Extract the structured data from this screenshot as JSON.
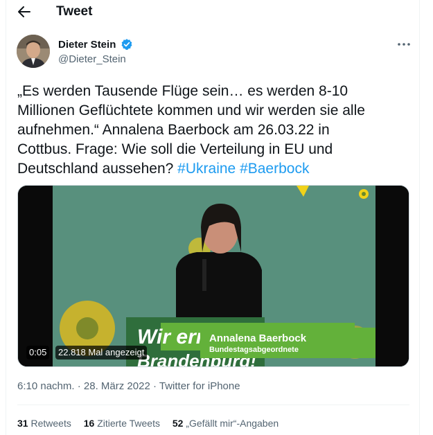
{
  "header": {
    "title": "Tweet"
  },
  "author": {
    "name": "Dieter Stein",
    "handle": "@Dieter_Stein"
  },
  "tweet": {
    "line1": "„Es werden Tausende Flüge sein… es werden 8-10",
    "line2": "Millionen Geflüchtete kommen und wir werden sie alle",
    "line3": "aufnehmen.“ Annalena Baerbock am 26.03.22 in",
    "line4": "Cottbus. Frage: Wie soll die Verteilung in EU und",
    "line5_text": "Deutschland aussehen? ",
    "hashtag1": "#Ukraine",
    "hashtag2": "#Baerbock"
  },
  "media": {
    "lower_third_name": "Annalena Baerbock",
    "lower_third_title": "Bundestagsabgeordnete",
    "banner_text_1": "Wir ern",
    "banner_text_2": "Brandenburg!",
    "time": "0:05",
    "views": "22.818 Mal angezeigt"
  },
  "meta": {
    "time": "6:10 nachm.",
    "date": "28. März 2022",
    "source": "Twitter for iPhone",
    "sep": " · "
  },
  "stats": {
    "retweets_count": "31",
    "retweets_label": "Retweets",
    "quotes_count": "16",
    "quotes_label": "Zitierte Tweets",
    "likes_count": "52",
    "likes_label": "„Gefällt mir“-Angaben"
  },
  "colors": {
    "link": "#1d9bf0",
    "verified": "#1d9bf0",
    "stage_green": "#5a8f7b",
    "lower_third": "#6fb53a"
  }
}
